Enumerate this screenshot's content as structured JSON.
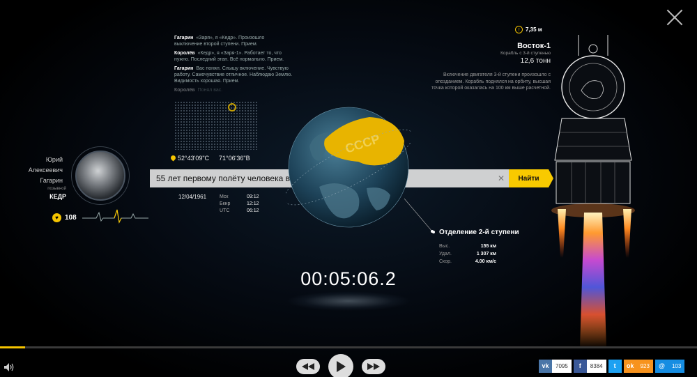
{
  "dialog": [
    {
      "speaker": "Гагарин",
      "text": "«Заря», я «Кедр». Произошло выключение второй ступени. Прием."
    },
    {
      "speaker": "Королёв",
      "text": "«Кедр», я «Заря-1». Работает то, что нужно. Последний этап. Всё нормально. Прием."
    },
    {
      "speaker": "Гагарин",
      "text": "Вас понял. Слышу включение. Чувствую работу. Самочувствие отличное. Наблюдаю Землю. Видимость хорошая. Прием."
    },
    {
      "speaker": "Королёв",
      "text": "Понял вас."
    }
  ],
  "location": {
    "lat": "52°43'09\"С",
    "lon": "71°06'36\"В"
  },
  "pilot": {
    "first_name": "Юрий",
    "patronymic": "Алексеевич",
    "last_name": "Гагарин",
    "callsign_label": "позывной",
    "callsign": "КЕДР",
    "pulse": "108"
  },
  "search": {
    "value": "55 лет первому полёту человека в космос",
    "button": "Найти"
  },
  "date": "12/04/1961",
  "times": [
    {
      "label": "Мск",
      "value": "09:12"
    },
    {
      "label": "Бкнр",
      "value": "12:12"
    },
    {
      "label": "UTC",
      "value": "06:12"
    }
  ],
  "globe": {
    "label": "СССР"
  },
  "stage_event": {
    "title": "Отделение 2-й ступени",
    "stats": [
      {
        "label": "Выс.",
        "value": "155 км"
      },
      {
        "label": "Удал.",
        "value": "1 307 км"
      },
      {
        "label": "Скор.",
        "value": "4.00 км/с"
      }
    ]
  },
  "timer": "00:05:06.2",
  "ship": {
    "height": "7,35 м",
    "name": "Восток-1",
    "subtitle": "Корабль с 3-й ступенью",
    "mass": "12,6 тонн",
    "description": "Включение двигателя 3-й ступени произошло с опозданием. Корабль поднялся на орбиту, высшая точка которой оказалась на 100 км выше расчетной."
  },
  "progress": 0.036,
  "social": [
    {
      "name": "vk",
      "label": "vk",
      "count": "7095",
      "color": "#4a76a8"
    },
    {
      "name": "facebook",
      "label": "f",
      "count": "8384",
      "color": "#3b5998"
    },
    {
      "name": "twitter",
      "label": "t",
      "count": "",
      "color": "#1da1f2"
    },
    {
      "name": "odnoklassniki",
      "label": "ok",
      "count": "923",
      "color": "#f7931e"
    },
    {
      "name": "moimir",
      "label": "@",
      "count": "103",
      "color": "#168de2"
    }
  ],
  "colors": {
    "accent": "#f5c400",
    "ussr": "#e8b400"
  }
}
